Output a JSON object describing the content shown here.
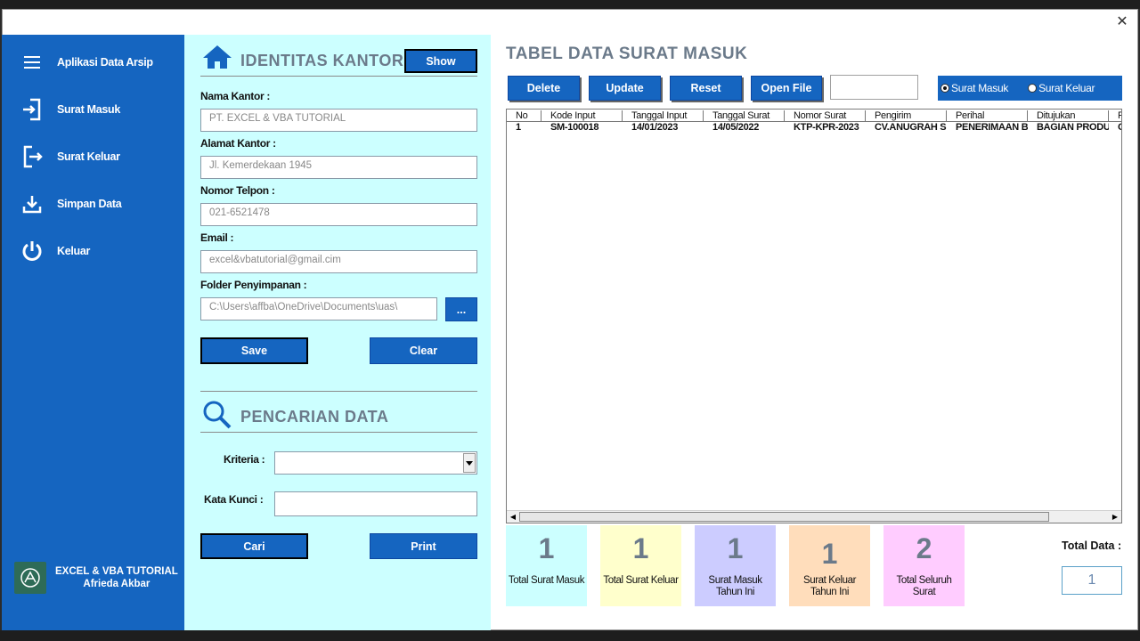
{
  "window": {
    "close_glyph": "✕"
  },
  "sidebar": {
    "items": [
      {
        "label": "Aplikasi Data Arsip",
        "icon": "menu-icon"
      },
      {
        "label": "Surat Masuk",
        "icon": "sign-in-icon"
      },
      {
        "label": "Surat Keluar",
        "icon": "sign-out-icon"
      },
      {
        "label": "Simpan Data",
        "icon": "download-icon"
      },
      {
        "label": "Keluar",
        "icon": "power-icon"
      }
    ],
    "brand": {
      "line1": "EXCEL & VBA TUTORIAL",
      "line2": "Afrieda Akbar",
      "icon": "brand-logo-icon"
    }
  },
  "identitas": {
    "title": "IDENTITAS KANTOR",
    "show_button": "Show",
    "fields": {
      "nama_label": "Nama Kantor :",
      "nama_value": "PT. EXCEL & VBA TUTORIAL",
      "alamat_label": "Alamat Kantor :",
      "alamat_value": "Jl. Kemerdekaan 1945",
      "telp_label": "Nomor Telpon :",
      "telp_value": "021-6521478",
      "email_label": "Email :",
      "email_value": "excel&vbatutorial@gmail.cim",
      "folder_label": "Folder Penyimpanan :",
      "folder_value": "C:\\Users\\affba\\OneDrive\\Documents\\uas\\",
      "browse_button": "..."
    },
    "save_button": "Save",
    "clear_button": "Clear"
  },
  "pencarian": {
    "title": "PENCARIAN DATA",
    "kriteria_label": "Kriteria :",
    "kriteria_value": "",
    "kata_kunci_label": "Kata Kunci :",
    "kata_kunci_value": "",
    "cari_button": "Cari",
    "print_button": "Print"
  },
  "tabel": {
    "title": "TABEL DATA SURAT MASUK",
    "buttons": {
      "delete": "Delete",
      "update": "Update",
      "reset": "Reset",
      "open_file": "Open File"
    },
    "search_value": "",
    "radio_masuk": "Surat Masuk",
    "radio_keluar": "Surat Keluar",
    "radio_selected": "Surat Masuk",
    "columns": [
      "No",
      "Kode Input",
      "Tanggal Input",
      "Tanggal Surat",
      "Nomor Surat",
      "Pengirim",
      "Perihal",
      "Ditujukan",
      "F"
    ],
    "rows": [
      [
        "1",
        "SM-100018",
        "14/01/2023",
        "14/05/2022",
        "KTP-KPR-2023",
        "CV.ANUGRAH S",
        "PENERIMAAN B",
        "BAGIAN PRODU",
        "C"
      ]
    ]
  },
  "summary": {
    "cards": [
      {
        "value": "1",
        "label": "Total Surat Masuk",
        "color": "#ccffff"
      },
      {
        "value": "1",
        "label": "Total Surat Keluar",
        "color": "#ffffcc"
      },
      {
        "value": "1",
        "label": "Surat Masuk Tahun Ini",
        "color": "#ccccff"
      },
      {
        "value": "1",
        "label": "Surat Keluar Tahun Ini",
        "color": "#ffddbb"
      },
      {
        "value": "2",
        "label": "Total Seluruh Surat",
        "color": "#ffccff"
      }
    ],
    "total_label": "Total Data :",
    "total_value": "1"
  },
  "colors": {
    "primary": "#1565c0",
    "panel": "#ccffff",
    "title_gray": "#6b7a8a"
  }
}
